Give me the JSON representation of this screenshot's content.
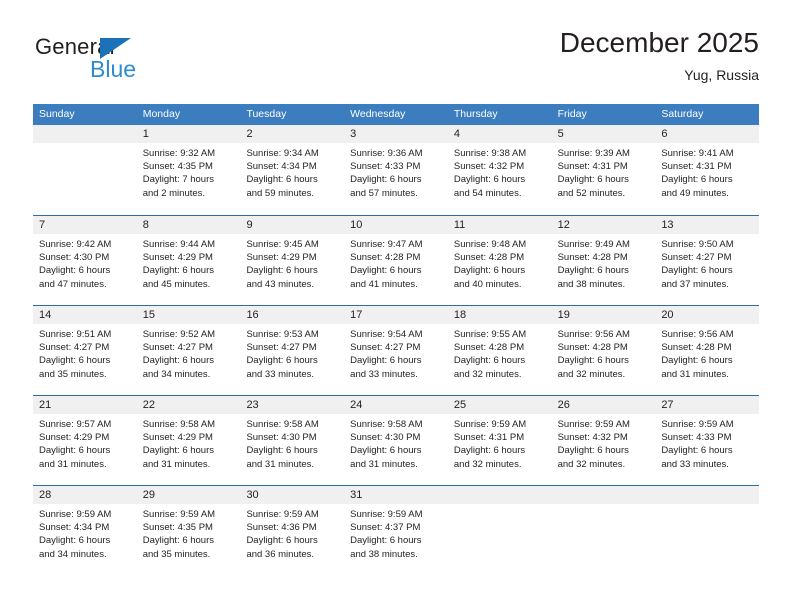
{
  "logo": {
    "word_top": "General",
    "word_bottom": "Blue",
    "triangle_color": "#1b72b8",
    "blue_text_color": "#2e8bd0"
  },
  "header": {
    "title": "December 2025",
    "location": "Yug, Russia"
  },
  "theme": {
    "header_row_bg": "#3b7dbf",
    "header_row_text": "#ffffff",
    "daynum_bg": "#f0f0f0",
    "row_divider": "#2e6ca4",
    "body_text": "#231f20"
  },
  "weekdays": [
    "Sunday",
    "Monday",
    "Tuesday",
    "Wednesday",
    "Thursday",
    "Friday",
    "Saturday"
  ],
  "weeks": [
    [
      {
        "day": "",
        "lines": []
      },
      {
        "day": "1",
        "lines": [
          "Sunrise: 9:32 AM",
          "Sunset: 4:35 PM",
          "Daylight: 7 hours",
          "and 2 minutes."
        ]
      },
      {
        "day": "2",
        "lines": [
          "Sunrise: 9:34 AM",
          "Sunset: 4:34 PM",
          "Daylight: 6 hours",
          "and 59 minutes."
        ]
      },
      {
        "day": "3",
        "lines": [
          "Sunrise: 9:36 AM",
          "Sunset: 4:33 PM",
          "Daylight: 6 hours",
          "and 57 minutes."
        ]
      },
      {
        "day": "4",
        "lines": [
          "Sunrise: 9:38 AM",
          "Sunset: 4:32 PM",
          "Daylight: 6 hours",
          "and 54 minutes."
        ]
      },
      {
        "day": "5",
        "lines": [
          "Sunrise: 9:39 AM",
          "Sunset: 4:31 PM",
          "Daylight: 6 hours",
          "and 52 minutes."
        ]
      },
      {
        "day": "6",
        "lines": [
          "Sunrise: 9:41 AM",
          "Sunset: 4:31 PM",
          "Daylight: 6 hours",
          "and 49 minutes."
        ]
      }
    ],
    [
      {
        "day": "7",
        "lines": [
          "Sunrise: 9:42 AM",
          "Sunset: 4:30 PM",
          "Daylight: 6 hours",
          "and 47 minutes."
        ]
      },
      {
        "day": "8",
        "lines": [
          "Sunrise: 9:44 AM",
          "Sunset: 4:29 PM",
          "Daylight: 6 hours",
          "and 45 minutes."
        ]
      },
      {
        "day": "9",
        "lines": [
          "Sunrise: 9:45 AM",
          "Sunset: 4:29 PM",
          "Daylight: 6 hours",
          "and 43 minutes."
        ]
      },
      {
        "day": "10",
        "lines": [
          "Sunrise: 9:47 AM",
          "Sunset: 4:28 PM",
          "Daylight: 6 hours",
          "and 41 minutes."
        ]
      },
      {
        "day": "11",
        "lines": [
          "Sunrise: 9:48 AM",
          "Sunset: 4:28 PM",
          "Daylight: 6 hours",
          "and 40 minutes."
        ]
      },
      {
        "day": "12",
        "lines": [
          "Sunrise: 9:49 AM",
          "Sunset: 4:28 PM",
          "Daylight: 6 hours",
          "and 38 minutes."
        ]
      },
      {
        "day": "13",
        "lines": [
          "Sunrise: 9:50 AM",
          "Sunset: 4:27 PM",
          "Daylight: 6 hours",
          "and 37 minutes."
        ]
      }
    ],
    [
      {
        "day": "14",
        "lines": [
          "Sunrise: 9:51 AM",
          "Sunset: 4:27 PM",
          "Daylight: 6 hours",
          "and 35 minutes."
        ]
      },
      {
        "day": "15",
        "lines": [
          "Sunrise: 9:52 AM",
          "Sunset: 4:27 PM",
          "Daylight: 6 hours",
          "and 34 minutes."
        ]
      },
      {
        "day": "16",
        "lines": [
          "Sunrise: 9:53 AM",
          "Sunset: 4:27 PM",
          "Daylight: 6 hours",
          "and 33 minutes."
        ]
      },
      {
        "day": "17",
        "lines": [
          "Sunrise: 9:54 AM",
          "Sunset: 4:27 PM",
          "Daylight: 6 hours",
          "and 33 minutes."
        ]
      },
      {
        "day": "18",
        "lines": [
          "Sunrise: 9:55 AM",
          "Sunset: 4:28 PM",
          "Daylight: 6 hours",
          "and 32 minutes."
        ]
      },
      {
        "day": "19",
        "lines": [
          "Sunrise: 9:56 AM",
          "Sunset: 4:28 PM",
          "Daylight: 6 hours",
          "and 32 minutes."
        ]
      },
      {
        "day": "20",
        "lines": [
          "Sunrise: 9:56 AM",
          "Sunset: 4:28 PM",
          "Daylight: 6 hours",
          "and 31 minutes."
        ]
      }
    ],
    [
      {
        "day": "21",
        "lines": [
          "Sunrise: 9:57 AM",
          "Sunset: 4:29 PM",
          "Daylight: 6 hours",
          "and 31 minutes."
        ]
      },
      {
        "day": "22",
        "lines": [
          "Sunrise: 9:58 AM",
          "Sunset: 4:29 PM",
          "Daylight: 6 hours",
          "and 31 minutes."
        ]
      },
      {
        "day": "23",
        "lines": [
          "Sunrise: 9:58 AM",
          "Sunset: 4:30 PM",
          "Daylight: 6 hours",
          "and 31 minutes."
        ]
      },
      {
        "day": "24",
        "lines": [
          "Sunrise: 9:58 AM",
          "Sunset: 4:30 PM",
          "Daylight: 6 hours",
          "and 31 minutes."
        ]
      },
      {
        "day": "25",
        "lines": [
          "Sunrise: 9:59 AM",
          "Sunset: 4:31 PM",
          "Daylight: 6 hours",
          "and 32 minutes."
        ]
      },
      {
        "day": "26",
        "lines": [
          "Sunrise: 9:59 AM",
          "Sunset: 4:32 PM",
          "Daylight: 6 hours",
          "and 32 minutes."
        ]
      },
      {
        "day": "27",
        "lines": [
          "Sunrise: 9:59 AM",
          "Sunset: 4:33 PM",
          "Daylight: 6 hours",
          "and 33 minutes."
        ]
      }
    ],
    [
      {
        "day": "28",
        "lines": [
          "Sunrise: 9:59 AM",
          "Sunset: 4:34 PM",
          "Daylight: 6 hours",
          "and 34 minutes."
        ]
      },
      {
        "day": "29",
        "lines": [
          "Sunrise: 9:59 AM",
          "Sunset: 4:35 PM",
          "Daylight: 6 hours",
          "and 35 minutes."
        ]
      },
      {
        "day": "30",
        "lines": [
          "Sunrise: 9:59 AM",
          "Sunset: 4:36 PM",
          "Daylight: 6 hours",
          "and 36 minutes."
        ]
      },
      {
        "day": "31",
        "lines": [
          "Sunrise: 9:59 AM",
          "Sunset: 4:37 PM",
          "Daylight: 6 hours",
          "and 38 minutes."
        ]
      },
      {
        "day": "",
        "lines": []
      },
      {
        "day": "",
        "lines": []
      },
      {
        "day": "",
        "lines": []
      }
    ]
  ]
}
